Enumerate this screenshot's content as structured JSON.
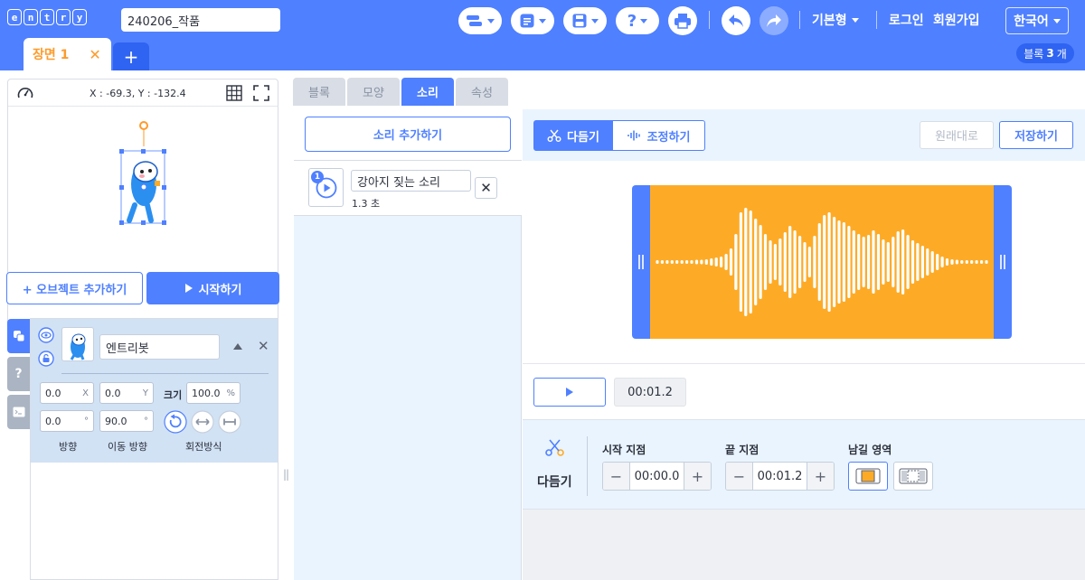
{
  "app": {
    "logo_letters": [
      "e",
      "n",
      "t",
      "r",
      "y"
    ],
    "project_title": "240206_작품",
    "mode_label": "기본형",
    "login_label": "로그인",
    "signup_label": "회원가입",
    "language_label": "한국어",
    "brand_color": "#4f80ff"
  },
  "toolbar_icons": [
    "block-menu-icon",
    "file-menu-icon",
    "save-menu-icon",
    "help-menu-icon",
    "print-icon",
    "undo-icon",
    "redo-icon"
  ],
  "help_glyph": "?",
  "scene": {
    "tab_label": "장면 1",
    "add_label": "+",
    "block_count_prefix": "블록",
    "block_count": "3",
    "block_count_suffix": "개"
  },
  "stage": {
    "coords": "X : -69.3, Y : -132.4"
  },
  "left_buttons": {
    "add_object": "+ 오브젝트 추가하기",
    "start": "시작하기"
  },
  "object": {
    "name": "엔트리봇",
    "x": "0.0",
    "x_unit": "X",
    "y": "0.0",
    "y_unit": "Y",
    "size_label": "크기",
    "size": "100.0",
    "size_unit": "%",
    "direction": "0.0",
    "move_direction": "90.0",
    "degree_unit": "°",
    "direction_label": "방향",
    "move_direction_label": "이동 방향",
    "rotation_label": "회전방식"
  },
  "side_help": "?",
  "tabs": [
    {
      "label": "블록"
    },
    {
      "label": "모양"
    },
    {
      "label": "소리"
    },
    {
      "label": "속성"
    }
  ],
  "sounds": {
    "add_label": "소리 추가하기",
    "items": [
      {
        "index": "1",
        "name": "강아지 짖는 소리",
        "duration": "1.3 초"
      }
    ]
  },
  "editor": {
    "trim_tab": "다듬기",
    "adjust_tab": "조정하기",
    "revert_label": "원래대로",
    "save_label": "저장하기",
    "time": "00:01.2",
    "trim_title": "다듬기",
    "start_label": "시작 지점",
    "start_value": "00:00.0",
    "end_label": "끝 지점",
    "end_value": "00:01.2",
    "keep_label": "남길 영역",
    "wave_color": "#fdab27"
  }
}
